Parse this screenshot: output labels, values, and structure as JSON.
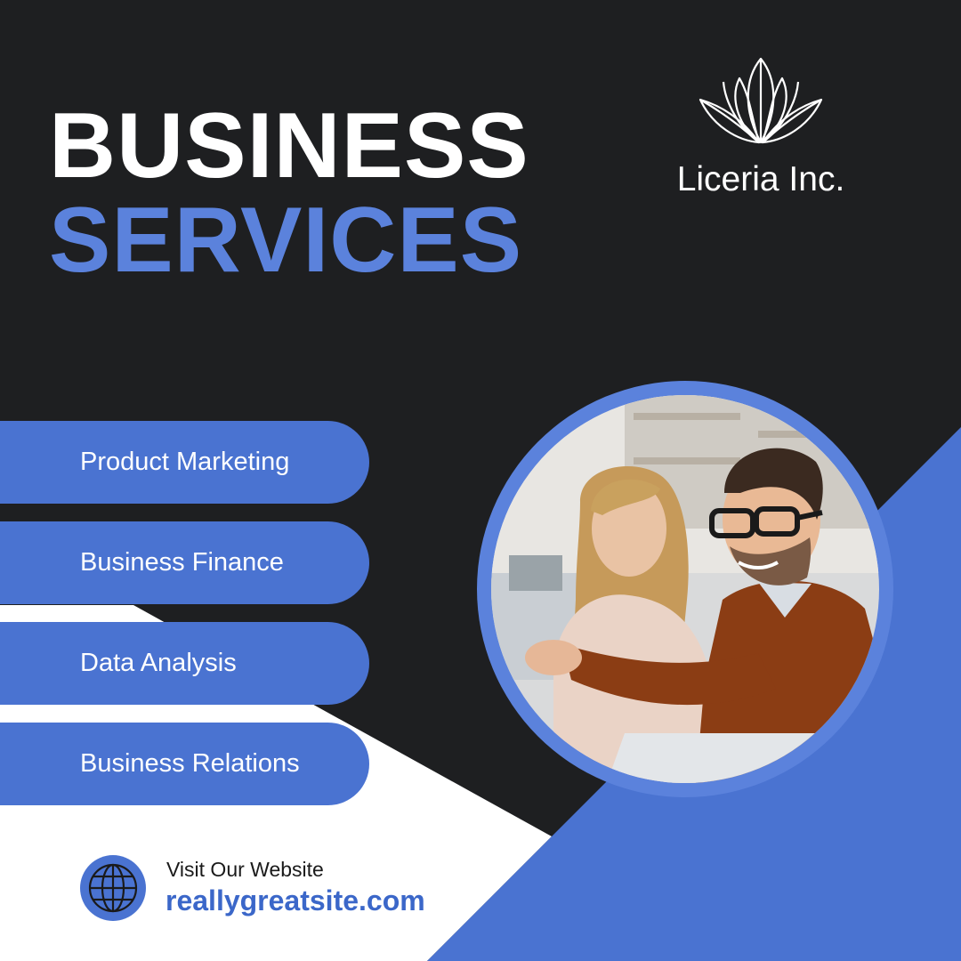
{
  "headline": {
    "line1": "BUSINESS",
    "line2": "SERVICES"
  },
  "brand": {
    "name": "Liceria Inc.",
    "logo_icon": "lotus-icon"
  },
  "services": [
    {
      "label": "Product Marketing"
    },
    {
      "label": "Business Finance"
    },
    {
      "label": "Data Analysis"
    },
    {
      "label": "Business Relations"
    }
  ],
  "photo": {
    "subject": "team-meeting-photo"
  },
  "footer": {
    "visit_label": "Visit Our Website",
    "url": "reallygreatsite.com",
    "icon": "globe-icon"
  },
  "colors": {
    "background": "#1e1f21",
    "accent": "#4a73d1",
    "accent_light": "#5b82dc",
    "white": "#ffffff",
    "text_dark": "#1a1a1a"
  }
}
